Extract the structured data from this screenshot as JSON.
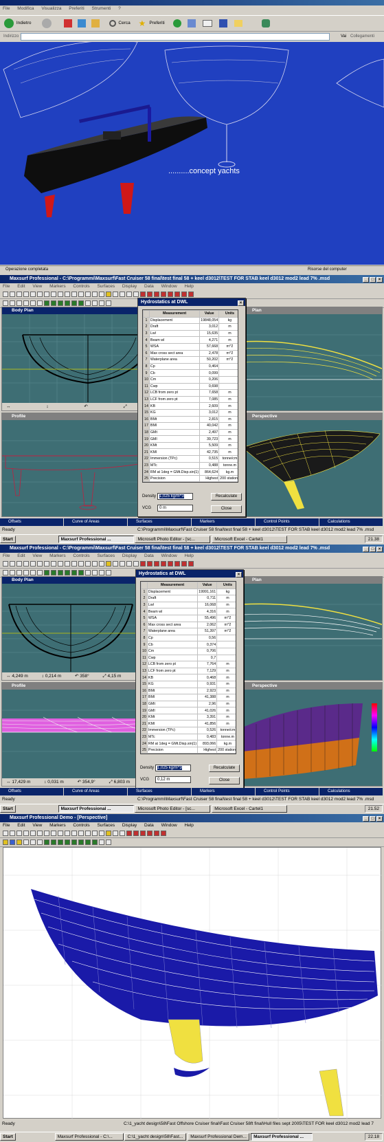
{
  "browser": {
    "menu": [
      "File",
      "Modifica",
      "Visualizza",
      "Preferiti",
      "Strumenti",
      "?"
    ],
    "back_label": "Indietro",
    "search_label": "Cerca",
    "favorites_label": "Preferiti",
    "address_label": "Indirizzo",
    "go_label": "Vai",
    "links_label": "Collegamenti",
    "caption": "..........concept yachts",
    "status_left": "Operazione completata",
    "status_right": "Risorse del computer"
  },
  "screen2": {
    "title": "Maxsurf Professional - C:\\Programmi\\Maxsurf\\Fast Cruiser 58 final\\test final 58 + keel d3012\\TEST FOR STAB keel d3012 mod2 lead 7% .msd",
    "menu": [
      "File",
      "Edit",
      "View",
      "Markers",
      "Controls",
      "Surfaces",
      "Display",
      "Data",
      "Window",
      "Help"
    ],
    "panes": {
      "body_plan": "Body Plan",
      "profile": "Profile",
      "perspective": "Perspective",
      "plan": "Plan"
    },
    "minis": [
      "Offsets",
      "Curve of Areas",
      "Surfaces",
      "Markers",
      "Control Points",
      "Calculations"
    ],
    "status": "Ready",
    "path": "C:\\Programmi\\Maxsurf\\Fast Cruiser 58 final\\test final 58 + keel d3012\\TEST FOR STAB keel d3012 mod2 lead 7% .msd",
    "taskbar": {
      "start": "Start",
      "items": [
        "Maxsurf Professional ...",
        "Microsoft Photo Editor - [sc...",
        "Microsoft Excel - Cartel1"
      ],
      "clock": "21.38"
    }
  },
  "dialog1": {
    "title": "Hydrostatics at DWL",
    "headers": [
      "Measurement",
      "Value",
      "Units"
    ],
    "rows": [
      [
        "1",
        "Displacement",
        "19848,054",
        "kg"
      ],
      [
        "2",
        "Draft",
        "3,012",
        "m"
      ],
      [
        "3",
        "Lwl",
        "15,635",
        "m"
      ],
      [
        "4",
        "Beam wl",
        "4,271",
        "m"
      ],
      [
        "5",
        "WSA",
        "57,668",
        "m^2"
      ],
      [
        "6",
        "Max cross sect area",
        "2,478",
        "m^2"
      ],
      [
        "7",
        "Waterplane area",
        "50,202",
        "m^2"
      ],
      [
        "8",
        "Cp",
        "0,464",
        ""
      ],
      [
        "9",
        "Cb",
        "0,099",
        ""
      ],
      [
        "10",
        "Cm",
        "0,206",
        ""
      ],
      [
        "11",
        "Cwp",
        "0,698",
        ""
      ],
      [
        "12",
        "LCB from zero pt",
        "7,658",
        "m"
      ],
      [
        "13",
        "LCF from zero pt",
        "7,085",
        "m"
      ],
      [
        "14",
        "KB",
        "2,609",
        "m"
      ],
      [
        "15",
        "KG",
        "3,012",
        "m"
      ],
      [
        "16",
        "BMt",
        "2,815",
        "m"
      ],
      [
        "17",
        "BMl",
        "40,042",
        "m"
      ],
      [
        "18",
        "GMt",
        "2,497",
        "m"
      ],
      [
        "19",
        "GMl",
        "39,723",
        "m"
      ],
      [
        "20",
        "KMt",
        "5,509",
        "m"
      ],
      [
        "21",
        "KMl",
        "42,735",
        "m"
      ],
      [
        "22",
        "Immersion (TPc)",
        "0,515",
        "tonne/cm"
      ],
      [
        "23",
        "MTc",
        "0,488",
        "tonne.m"
      ],
      [
        "24",
        "RM at 1deg = GMt.Disp.sin(1)",
        "864,624",
        "kg.m"
      ],
      [
        "25",
        "Precision",
        "Highest",
        "200 stations"
      ]
    ],
    "density_label": "Density",
    "density_value": "1,025 kg/m^3",
    "vcg_label": "VCG",
    "vcg_value": "0 m",
    "recalc": "Recalculate",
    "close": "Close"
  },
  "screen3": {
    "title": "Maxsurf Professional - C:\\Programmi\\Maxsurf\\Fast Cruiser 58 final\\test final 58 + keel d3012\\TEST FOR STAB keel d3012 mod2 lead 7% .msd",
    "menu": [
      "File",
      "Edit",
      "View",
      "Markers",
      "Controls",
      "Surfaces",
      "Display",
      "Data",
      "Window",
      "Help"
    ],
    "panes": {
      "body_plan": "Body Plan",
      "profile": "Profile",
      "perspective": "Perspective",
      "plan": "Plan"
    },
    "body_footer": [
      "4,249 m",
      "0,214 m",
      "358°",
      "4,15 m"
    ],
    "profile_footer": [
      "17,429 m",
      "0,031 m",
      "354,9°",
      "6,803 m"
    ],
    "minis": [
      "Offsets",
      "Curve of Areas",
      "Surfaces",
      "Markers",
      "Control Points",
      "Calculations"
    ],
    "status": "Ready",
    "path": "C:\\Programmi\\Maxsurf\\Fast Cruiser 58 final\\test final 58 + keel d3012\\TEST FOR STAB keel d3012 mod2 lead 7% .msd",
    "taskbar": {
      "start": "Start",
      "items": [
        "Maxsurf Professional ...",
        "Microsoft Photo Editor - [sc...",
        "Microsoft Excel - Cartel1"
      ],
      "clock": "21.52"
    }
  },
  "dialog2": {
    "title": "Hydrostatics at DWL",
    "headers": [
      "Measurement",
      "Value",
      "Units"
    ],
    "rows": [
      [
        "1",
        "Displacement",
        "19991,161",
        "kg"
      ],
      [
        "2",
        "Draft",
        "0,711",
        "m"
      ],
      [
        "3",
        "Lwl",
        "16,068",
        "m"
      ],
      [
        "4",
        "Beam wl",
        "4,316",
        "m"
      ],
      [
        "5",
        "WSA",
        "55,496",
        "m^2"
      ],
      [
        "6",
        "Max cross sect area",
        "2,062",
        "m^2"
      ],
      [
        "7",
        "Waterplane area",
        "51,397",
        "m^2"
      ],
      [
        "8",
        "Cp",
        "0,56",
        ""
      ],
      [
        "9",
        "Cb",
        "0,374",
        ""
      ],
      [
        "10",
        "Cm",
        "0,706",
        ""
      ],
      [
        "11",
        "Cwp",
        "0,7",
        ""
      ],
      [
        "12",
        "LCB from zero pt",
        "7,764",
        "m"
      ],
      [
        "13",
        "LCF from zero pt",
        "7,129",
        "m"
      ],
      [
        "14",
        "KB",
        "0,468",
        "m"
      ],
      [
        "15",
        "KG",
        "0,931",
        "m"
      ],
      [
        "16",
        "BMt",
        "2,923",
        "m"
      ],
      [
        "17",
        "BMl",
        "41,388",
        "m"
      ],
      [
        "18",
        "GMt",
        "2,96",
        "m"
      ],
      [
        "19",
        "GMl",
        "41,026",
        "m"
      ],
      [
        "20",
        "KMt",
        "3,391",
        "m"
      ],
      [
        "21",
        "KMl",
        "41,856",
        "m"
      ],
      [
        "22",
        "Immersion (TPc)",
        "0,526",
        "tonne/cm"
      ],
      [
        "23",
        "MTc",
        "0,483",
        "tonne.m"
      ],
      [
        "24",
        "RM at 1deg = GMt.Disp.sin(1)",
        "893,066",
        "kg.m"
      ],
      [
        "25",
        "Precision",
        "Highest",
        "200 stations"
      ]
    ],
    "density_label": "Density",
    "density_value": "1,025 kg/m^3",
    "vcg_label": "VCG",
    "vcg_value": "0,12 m",
    "recalc": "Recalculate",
    "close": "Close"
  },
  "screen4": {
    "title": "Maxsurf Professional Demo - [Perspective]",
    "menu": [
      "File",
      "Edit",
      "View",
      "Markers",
      "Controls",
      "Surfaces",
      "Display",
      "Data",
      "Window",
      "Help"
    ],
    "status": "Ready",
    "path": "C:\\1_yacht design\\58\\Fast Offshore Cruiser final\\Fast Cruiser 58ft final\\Hull files sept 2005\\TEST FOR keel d3012 mod2 lead 7",
    "taskbar": {
      "start": "Start",
      "items": [
        "Maxsurf Professional - C:\\...",
        "C:\\1_yacht design\\58\\Fast...",
        "Maxsurf Professional Dem...",
        "Maxsurf Professional ..."
      ],
      "clock": "22.18"
    }
  },
  "colors": {
    "titlebar": "#0a246a",
    "viewport_teal": "#3e6e74",
    "browser_blue": "#2040c0",
    "hull_blue": "#1a1aa8",
    "appendage_yellow": "#f0e040"
  }
}
